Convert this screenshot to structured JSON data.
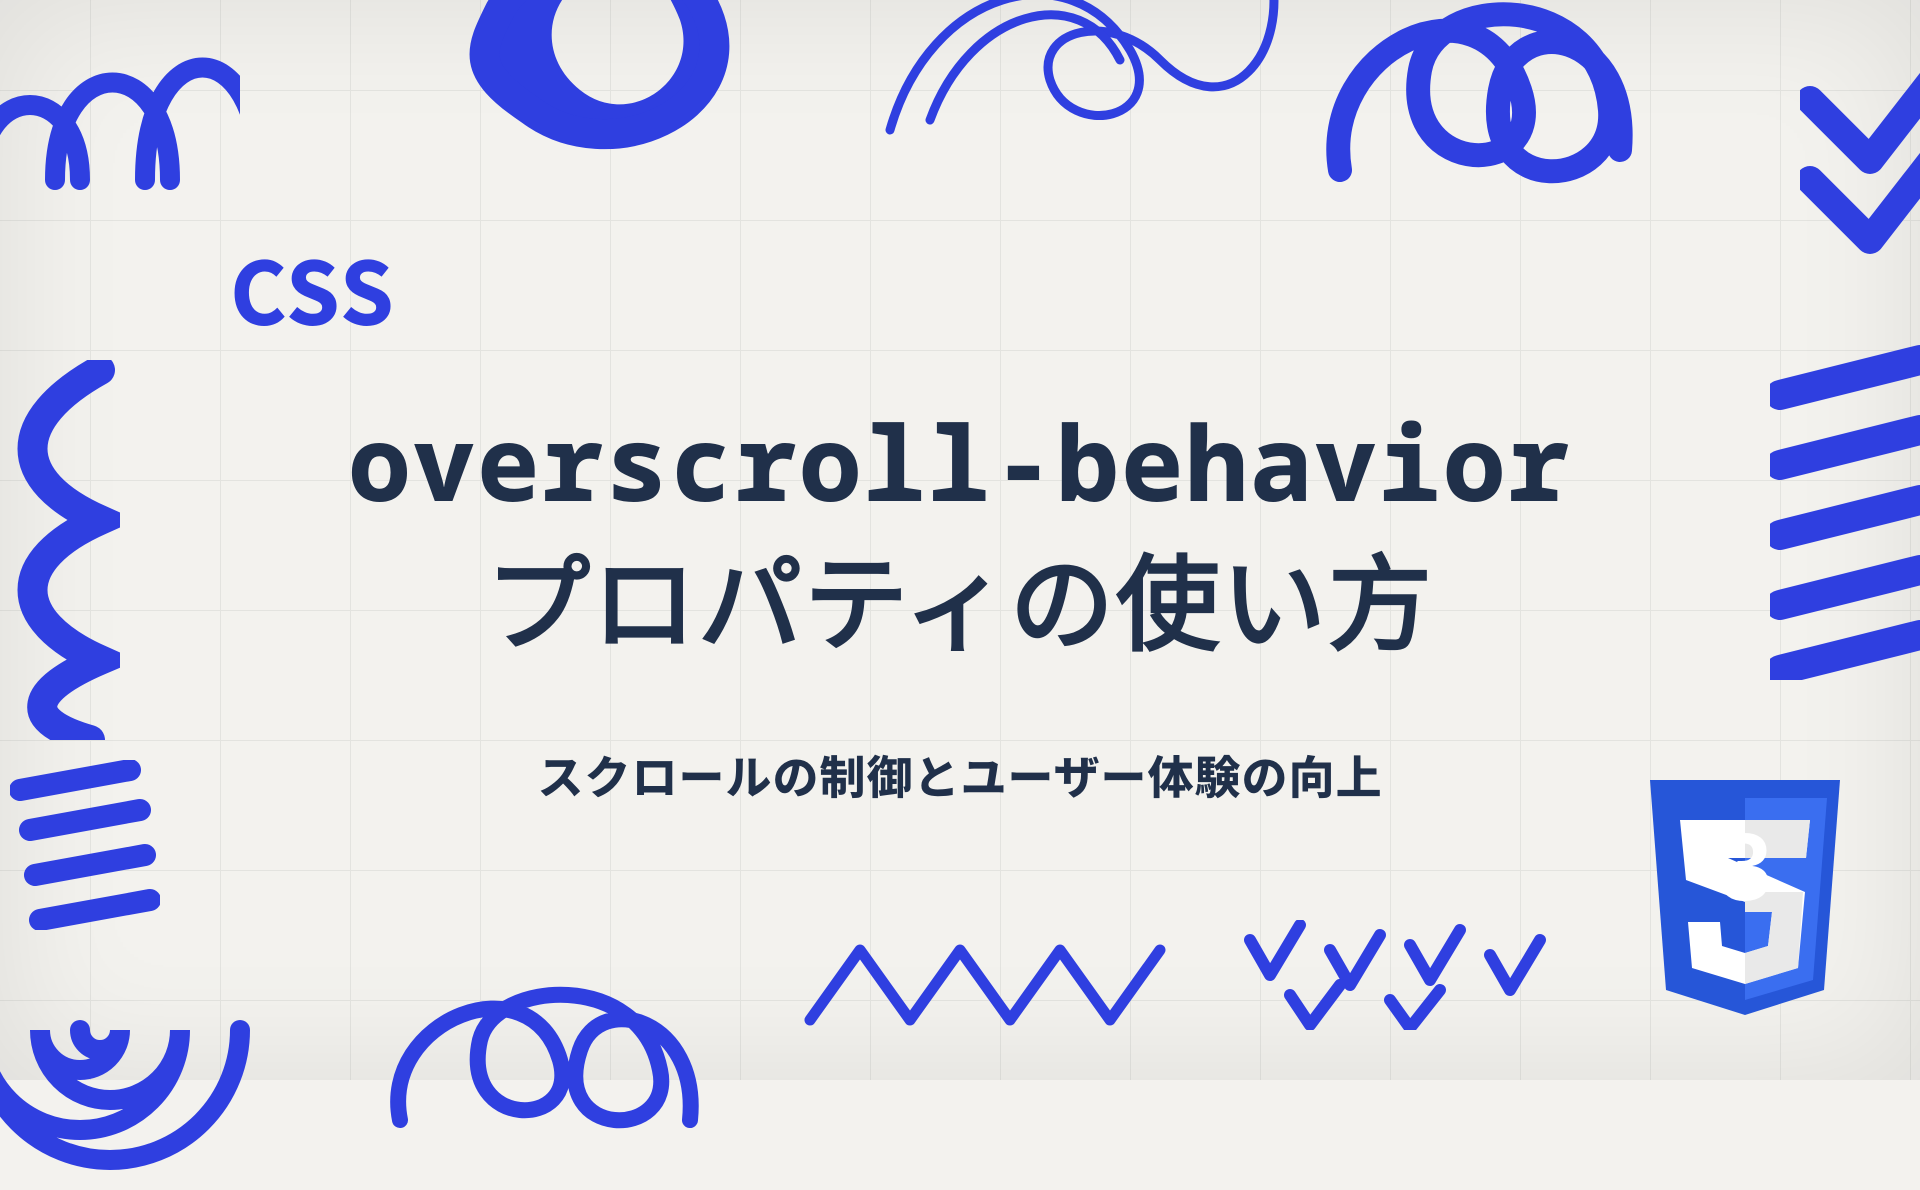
{
  "category": "CSS",
  "title_line1": "overscroll-behavior",
  "title_line2": "プロパティの使い方",
  "subtitle": "スクロールの制御とユーザー体験の向上",
  "badge": "3",
  "colors": {
    "accent": "#2f3fe0",
    "text": "#20304a",
    "paper": "#f3f2ee",
    "grid": "#e3e3df",
    "badge_bg": "#2656d8",
    "badge_fold": "#1b3ea8"
  }
}
